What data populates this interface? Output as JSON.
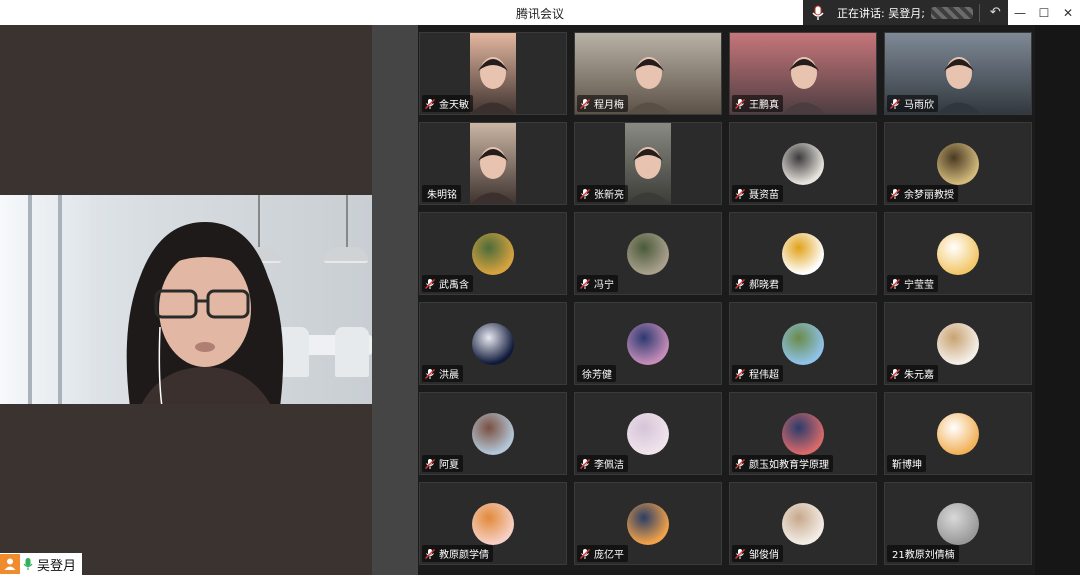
{
  "app": {
    "title": "腾讯会议",
    "speaking_label": "正在讲话: 吴登月;",
    "icons": {
      "undo": "undo-icon",
      "minimize": "minimize-icon",
      "maximize": "maximize-icon",
      "close": "close-icon"
    }
  },
  "main": {
    "speaker_name": "吴登月",
    "colors": {
      "badge": "#f08b2e",
      "mic": "#2fb15a"
    }
  },
  "participants": [
    {
      "name": "金天敏",
      "mic": true,
      "kind": "video",
      "colors": [
        "#e3b7a0",
        "#3b302d"
      ]
    },
    {
      "name": "程月梅",
      "mic": true,
      "kind": "video",
      "colors": [
        "#b9b2a6",
        "#5a4f44"
      ]
    },
    {
      "name": "王鹏真",
      "mic": true,
      "kind": "video",
      "colors": [
        "#c6767a",
        "#4b3c40"
      ]
    },
    {
      "name": "马雨欣",
      "mic": true,
      "kind": "video",
      "colors": [
        "#7f8a96",
        "#30363d"
      ]
    },
    {
      "name": "朱明铭",
      "mic": false,
      "kind": "video",
      "colors": [
        "#cbb6a4",
        "#3b302d"
      ]
    },
    {
      "name": "张新亮",
      "mic": true,
      "kind": "video",
      "colors": [
        "#8a8a84",
        "#3a3a36"
      ]
    },
    {
      "name": "聂资苗",
      "mic": true,
      "kind": "avatar",
      "colors": [
        "#e8e4de",
        "#3b3b3b"
      ]
    },
    {
      "name": "余梦丽教授",
      "mic": true,
      "kind": "avatar",
      "colors": [
        "#d2b97c",
        "#4a3a22"
      ]
    },
    {
      "name": "武禹含",
      "mic": true,
      "kind": "avatar",
      "colors": [
        "#d7a33f",
        "#4c6b3a"
      ]
    },
    {
      "name": "冯宁",
      "mic": true,
      "kind": "avatar",
      "colors": [
        "#a9a08c",
        "#4b5a3a"
      ]
    },
    {
      "name": "郝晓君",
      "mic": true,
      "kind": "avatar",
      "colors": [
        "#ffffff",
        "#e0a21a"
      ]
    },
    {
      "name": "宁莹莹",
      "mic": true,
      "kind": "avatar",
      "colors": [
        "#f3c76a",
        "#ffffff"
      ]
    },
    {
      "name": "洪晨",
      "mic": true,
      "kind": "avatar",
      "colors": [
        "#0f1a3a",
        "#e8e8f0"
      ]
    },
    {
      "name": "徐芳健",
      "mic": false,
      "kind": "avatar",
      "colors": [
        "#c58db8",
        "#2c3a70"
      ]
    },
    {
      "name": "程伟超",
      "mic": true,
      "kind": "avatar",
      "colors": [
        "#8fc3e8",
        "#6a8a4a"
      ]
    },
    {
      "name": "朱元嘉",
      "mic": true,
      "kind": "avatar",
      "colors": [
        "#f4efe8",
        "#c9a272"
      ]
    },
    {
      "name": "阿夏",
      "mic": true,
      "kind": "avatar",
      "colors": [
        "#b4c7d9",
        "#7a5040"
      ]
    },
    {
      "name": "李佩洁",
      "mic": true,
      "kind": "avatar",
      "colors": [
        "#efe4ec",
        "#d6c4d8"
      ]
    },
    {
      "name": "颜玉如教育学原理",
      "mic": true,
      "kind": "avatar",
      "colors": [
        "#d86a6a",
        "#2b3b6b"
      ]
    },
    {
      "name": "靳博坤",
      "mic": false,
      "kind": "avatar",
      "colors": [
        "#f2b25a",
        "#ffffff"
      ]
    },
    {
      "name": "教原颜学倩",
      "mic": true,
      "kind": "avatar",
      "colors": [
        "#f6d0c4",
        "#e28a3a"
      ]
    },
    {
      "name": "庞亿平",
      "mic": true,
      "kind": "avatar",
      "colors": [
        "#f2a24a",
        "#2b3e66"
      ]
    },
    {
      "name": "邹俊俏",
      "mic": true,
      "kind": "avatar",
      "colors": [
        "#f3ede6",
        "#c7a88c"
      ]
    },
    {
      "name": "21教原刘倩楠",
      "mic": false,
      "kind": "avatar",
      "colors": [
        "#9a9a9a",
        "#d9d9d9"
      ]
    }
  ]
}
